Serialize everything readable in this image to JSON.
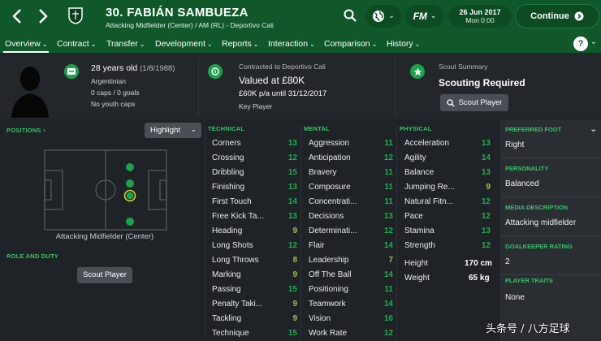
{
  "header": {
    "title": "30. FABIÁN SAMBUEZA",
    "subtitle": "Attacking Midfielder (Center) / AM (RL) - Deportivo Cali",
    "date": "26 Jun 2017",
    "day_time": "Mon 0:00",
    "continue_label": "Continue",
    "fm_label": "FM"
  },
  "tabs": [
    {
      "label": "Overview"
    },
    {
      "label": "Contract"
    },
    {
      "label": "Transfer"
    },
    {
      "label": "Development"
    },
    {
      "label": "Reports"
    },
    {
      "label": "Interaction"
    },
    {
      "label": "Comparison"
    },
    {
      "label": "History"
    }
  ],
  "help_label": "?",
  "info": {
    "age": "28 years old",
    "dob": "(1/8/1988)",
    "nationality": "Argentinian",
    "caps": "0 caps / 0 goals",
    "youth_caps": "No youth caps",
    "contract_line": "Contracted to Deportivo Cali",
    "value": "Valued at £80K",
    "wage": "£60K p/a until 31/12/2017",
    "status": "Key Player",
    "scout_summary_label": "Scout Summary",
    "scouting_required": "Scouting Required",
    "scout_button": "Scout Player"
  },
  "left": {
    "positions_label": "POSITIONS",
    "highlight_label": "Highlight",
    "position_caption": "Attacking Midfielder (Center)",
    "role_label": "ROLE AND DUTY",
    "scout_button": "Scout Player"
  },
  "technical": {
    "label": "TECHNICAL",
    "rows": [
      {
        "name": "Corners",
        "value": "13"
      },
      {
        "name": "Crossing",
        "value": "12"
      },
      {
        "name": "Dribbling",
        "value": "15"
      },
      {
        "name": "Finishing",
        "value": "13"
      },
      {
        "name": "First Touch",
        "value": "14"
      },
      {
        "name": "Free Kick Ta...",
        "value": "13"
      },
      {
        "name": "Heading",
        "value": "9"
      },
      {
        "name": "Long Shots",
        "value": "12"
      },
      {
        "name": "Long Throws",
        "value": "8"
      },
      {
        "name": "Marking",
        "value": "9"
      },
      {
        "name": "Passing",
        "value": "15"
      },
      {
        "name": "Penalty Taki...",
        "value": "9"
      },
      {
        "name": "Tackling",
        "value": "9"
      },
      {
        "name": "Technique",
        "value": "15"
      }
    ]
  },
  "mental": {
    "label": "MENTAL",
    "rows": [
      {
        "name": "Aggression",
        "value": "11"
      },
      {
        "name": "Anticipation",
        "value": "12"
      },
      {
        "name": "Bravery",
        "value": "11"
      },
      {
        "name": "Composure",
        "value": "11"
      },
      {
        "name": "Concentrati...",
        "value": "11"
      },
      {
        "name": "Decisions",
        "value": "13"
      },
      {
        "name": "Determinati...",
        "value": "12"
      },
      {
        "name": "Flair",
        "value": "14"
      },
      {
        "name": "Leadership",
        "value": "7"
      },
      {
        "name": "Off The Ball",
        "value": "14"
      },
      {
        "name": "Positioning",
        "value": "11"
      },
      {
        "name": "Teamwork",
        "value": "14"
      },
      {
        "name": "Vision",
        "value": "16"
      },
      {
        "name": "Work Rate",
        "value": "12"
      }
    ]
  },
  "physical": {
    "label": "PHYSICAL",
    "rows": [
      {
        "name": "Acceleration",
        "value": "13"
      },
      {
        "name": "Agility",
        "value": "14"
      },
      {
        "name": "Balance",
        "value": "13"
      },
      {
        "name": "Jumping Re...",
        "value": "9"
      },
      {
        "name": "Natural Fitn...",
        "value": "12"
      },
      {
        "name": "Pace",
        "value": "12"
      },
      {
        "name": "Stamina",
        "value": "13"
      },
      {
        "name": "Strength",
        "value": "12"
      }
    ],
    "height_label": "Height",
    "height_value": "170 cm",
    "weight_label": "Weight",
    "weight_value": "65 kg"
  },
  "right": {
    "preferred_foot_label": "PREFERRED FOOT",
    "preferred_foot": "Right",
    "personality_label": "PERSONALITY",
    "personality": "Balanced",
    "media_label": "MEDIA DESCRIPTION",
    "media": "Attacking midfielder",
    "gk_label": "GOALKEEPER RATING",
    "gk": "2",
    "traits_label": "PLAYER TRAITS",
    "traits": "None"
  },
  "watermark": "头条号 / 八方足球",
  "colors": {
    "header_green": "#10582a",
    "accent_green": "#19a34a",
    "value_green": "#19b24f",
    "value_mid": "#9bc64a"
  }
}
